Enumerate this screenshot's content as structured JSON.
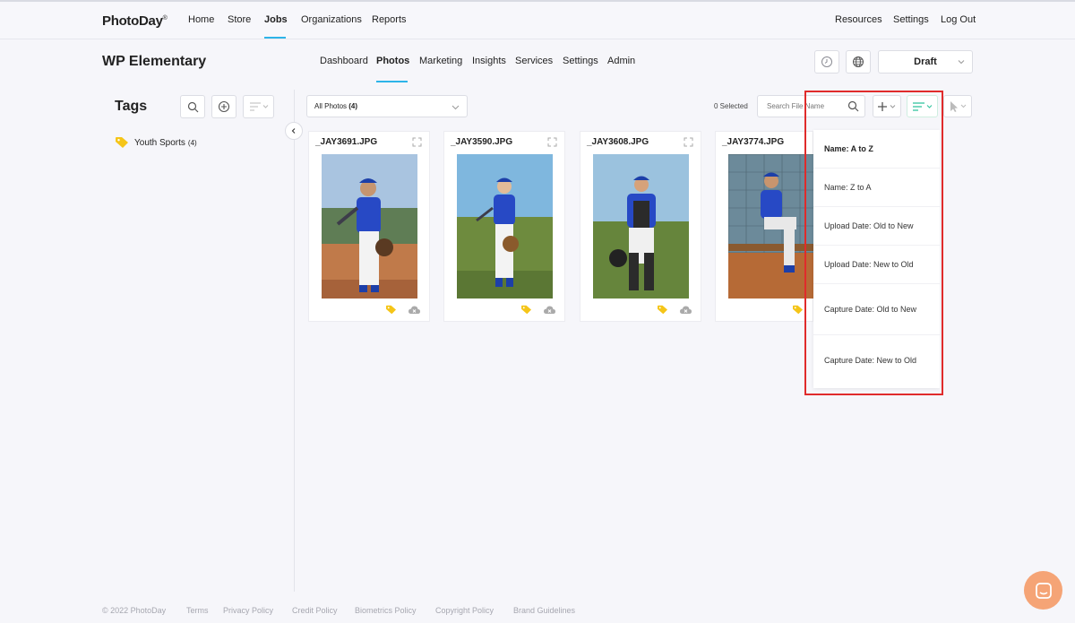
{
  "app": {
    "logo": "PhotoDay",
    "logo_mark": "®"
  },
  "topnav": {
    "left": [
      "Home",
      "Store",
      "Jobs",
      "Organizations",
      "Reports"
    ],
    "active": "Jobs",
    "right": [
      "Resources",
      "Settings",
      "Log Out"
    ]
  },
  "job": {
    "title": "WP Elementary"
  },
  "subnav": {
    "items": [
      "Dashboard",
      "Photos",
      "Marketing",
      "Insights",
      "Services",
      "Settings",
      "Admin"
    ],
    "active": "Photos"
  },
  "status_select": {
    "value": "Draft"
  },
  "sidebar": {
    "title": "Tags",
    "tags": [
      {
        "label": "Youth Sports",
        "count": "(4)",
        "color": "#f5c518"
      }
    ]
  },
  "toolbar": {
    "filter_label": "All Photos",
    "filter_count": "(4)",
    "selected_text": "0 Selected",
    "search_placeholder": "Search File Name"
  },
  "photos": [
    {
      "filename": "_JAY3691.JPG"
    },
    {
      "filename": "_JAY3590.JPG"
    },
    {
      "filename": "_JAY3608.JPG"
    },
    {
      "filename": "_JAY3774.JPG"
    }
  ],
  "sort_menu": {
    "items": [
      "Name: A to Z",
      "Name: Z to A",
      "Upload Date: Old to New",
      "Upload Date: New to Old",
      "Capture Date: Old to New",
      "Capture Date: New to Old"
    ]
  },
  "footer": {
    "copyright": "© 2022 PhotoDay",
    "links": [
      "Terms",
      "Privacy Policy",
      "Credit Policy",
      "Biometrics Policy",
      "Copyright Policy",
      "Brand Guidelines"
    ]
  },
  "colors": {
    "accent": "#2db4e8",
    "highlight": "#e02b2b",
    "chat": "#f5a476",
    "tag": "#f5c518"
  }
}
